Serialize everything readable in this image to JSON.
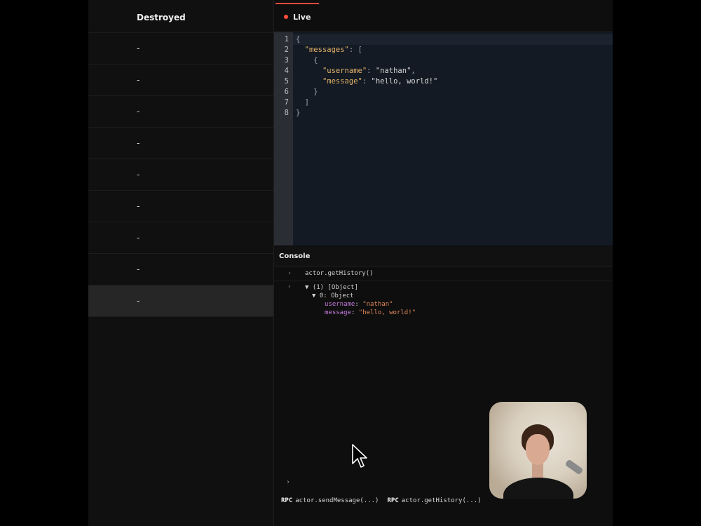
{
  "left_panel": {
    "header": "Destroyed",
    "rows": [
      "-",
      "-",
      "-",
      "-",
      "-",
      "-",
      "-",
      "-",
      "-"
    ]
  },
  "tabs": {
    "live_label": "Live"
  },
  "editor": {
    "line_numbers": [
      "1",
      "2",
      "3",
      "4",
      "5",
      "6",
      "7",
      "8"
    ],
    "json_key_messages": "\"messages\"",
    "json_key_username": "\"username\"",
    "json_val_username": "\"nathan\"",
    "json_key_message": "\"message\"",
    "json_val_message": "\"hello, world!\""
  },
  "console": {
    "title": "Console",
    "input_command": "actor.getHistory()",
    "output_header": "▼ (1) [Object]",
    "output_item": "▼ 0: Object",
    "field_username_key": "username",
    "field_username_val": "\"nathan\"",
    "field_message_key": "message",
    "field_message_val": "\"hello, world!\"",
    "prompt_symbol": "›"
  },
  "rpc": [
    {
      "tag": "RPC",
      "call": "actor.sendMessage(...)"
    },
    {
      "tag": "RPC",
      "call": "actor.getHistory(...)"
    }
  ],
  "colors": {
    "live_dot": "#ff4d3a",
    "json_key": "#e3b26a",
    "console_key": "#c87de0",
    "console_string": "#e08a5a"
  }
}
